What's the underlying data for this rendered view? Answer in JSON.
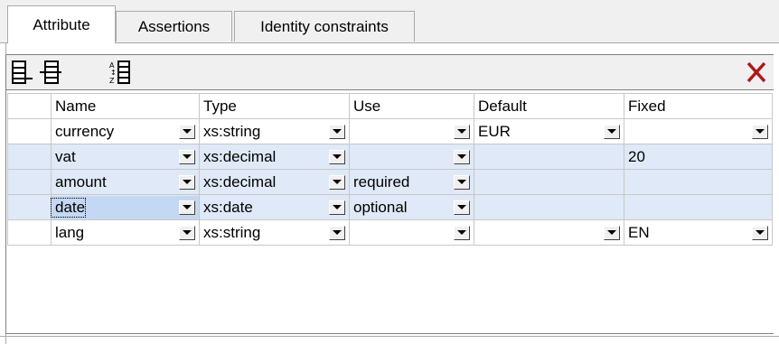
{
  "tabs": [
    {
      "label": "Attribute",
      "active": true
    },
    {
      "label": "Assertions",
      "active": false
    },
    {
      "label": "Identity constraints",
      "active": false
    }
  ],
  "toolbar": {
    "buttons": [
      "append-row-icon",
      "insert-row-icon",
      "sort-icon"
    ],
    "delete_icon": "delete-x-icon",
    "delete_color": "#b01818"
  },
  "grid": {
    "headers": {
      "name": "Name",
      "type": "Type",
      "use": "Use",
      "default": "Default",
      "fixed": "Fixed"
    },
    "rows": [
      {
        "name": "currency",
        "type": "xs:string",
        "use": "",
        "default": "EUR",
        "fixed": ""
      },
      {
        "name": "vat",
        "type": "xs:decimal",
        "use": "",
        "default": "",
        "fixed": "20"
      },
      {
        "name": "amount",
        "type": "xs:decimal",
        "use": "required",
        "default": "",
        "fixed": ""
      },
      {
        "name": "date",
        "type": "xs:date",
        "use": "optional",
        "default": "",
        "fixed": ""
      },
      {
        "name": "lang",
        "type": "xs:string",
        "use": "",
        "default": "",
        "fixed": "EN"
      }
    ]
  },
  "colors": {
    "row_highlight": "#dfe9f7",
    "selected_cell": "#c5d8f3"
  }
}
